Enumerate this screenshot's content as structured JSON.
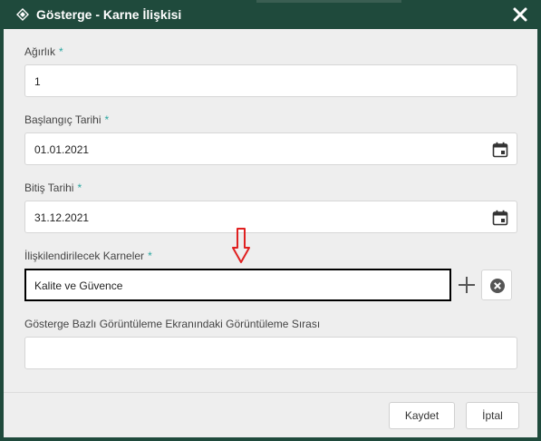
{
  "dialog": {
    "title": "Gösterge - Karne İlişkisi"
  },
  "form": {
    "weight": {
      "label": "Ağırlık",
      "required_mark": "*",
      "value": "1"
    },
    "start_date": {
      "label": "Başlangıç Tarihi",
      "required_mark": "*",
      "value": "01.01.2021"
    },
    "end_date": {
      "label": "Bitiş Tarihi",
      "required_mark": "*",
      "value": "31.12.2021"
    },
    "scorecards": {
      "label": "İlişkilendirilecek Karneler",
      "required_mark": "*",
      "value": "Kalite ve Güvence"
    },
    "display_order": {
      "label": "Gösterge Bazlı Görüntüleme Ekranındaki Görüntüleme Sırası",
      "value": ""
    }
  },
  "footer": {
    "save_label": "Kaydet",
    "cancel_label": "İptal"
  },
  "icons": {
    "title": "diamond-icon",
    "close": "close-icon",
    "calendar": "calendar-icon",
    "add": "plus-icon",
    "clear": "clear-circle-icon",
    "annotation": "red-down-arrow-icon"
  },
  "colors": {
    "header_bg": "#1f4a3c",
    "body_bg": "#eeeeee",
    "required_mark": "#2aa6a0",
    "annotation_arrow": "#e02020"
  }
}
